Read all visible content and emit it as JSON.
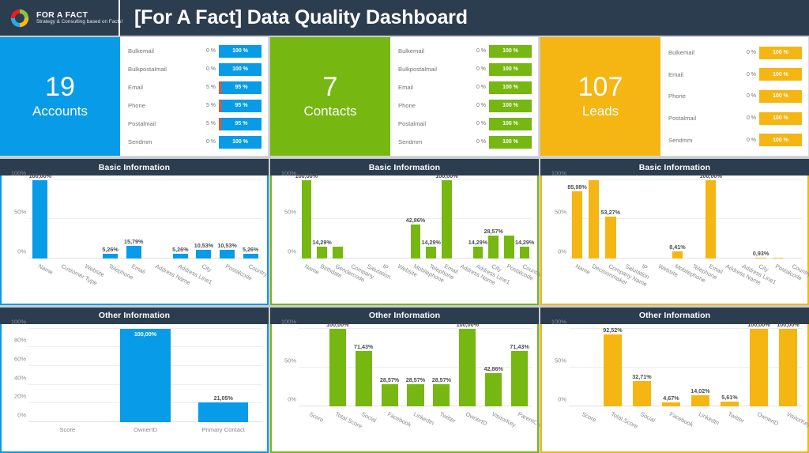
{
  "header": {
    "logo_title": "FOR A FACT",
    "logo_tagline": "Strategy & Consulting based on Facts!",
    "logo_icon": "circular-ring-logo",
    "title": "[For A Fact] Data Quality Dashboard",
    "background_color": "#2b3d4f"
  },
  "colors": {
    "accent_blue": "#079be8",
    "accent_green": "#76b711",
    "accent_orange": "#f5b512",
    "bad_red": "#e8562a",
    "panel_dark": "#2b3d4f",
    "page_background": "#c9ccd1"
  },
  "columns": [
    {
      "key": "accounts",
      "accent": "#079be8",
      "kpi": {
        "count": "19",
        "label": "Accounts",
        "rows": [
          {
            "name": "Bulkemail",
            "bad": "0 %",
            "good": "100 %",
            "bad_pct": 0
          },
          {
            "name": "Bulkpostalmail",
            "bad": "0 %",
            "good": "100 %",
            "bad_pct": 0
          },
          {
            "name": "Email",
            "bad": "5 %",
            "good": "95 %",
            "bad_pct": 5
          },
          {
            "name": "Phone",
            "bad": "5 %",
            "good": "95 %",
            "bad_pct": 5
          },
          {
            "name": "Postalmail",
            "bad": "5 %",
            "good": "95 %",
            "bad_pct": 5
          },
          {
            "name": "Sendmm",
            "bad": "0 %",
            "good": "100 %",
            "bad_pct": 0
          }
        ]
      },
      "basic_title": "Basic Information",
      "other_title": "Other Information"
    },
    {
      "key": "contacts",
      "accent": "#76b711",
      "kpi": {
        "count": "7",
        "label": "Contacts",
        "rows": [
          {
            "name": "Bulkemail",
            "bad": "0 %",
            "good": "100 %",
            "bad_pct": 0
          },
          {
            "name": "Bulkpostalmail",
            "bad": "0 %",
            "good": "100 %",
            "bad_pct": 0
          },
          {
            "name": "Email",
            "bad": "0 %",
            "good": "100 %",
            "bad_pct": 0
          },
          {
            "name": "Phone",
            "bad": "0 %",
            "good": "100 %",
            "bad_pct": 0
          },
          {
            "name": "Postalmail",
            "bad": "0 %",
            "good": "100 %",
            "bad_pct": 0
          },
          {
            "name": "Sendmm",
            "bad": "0 %",
            "good": "100 %",
            "bad_pct": 0
          }
        ]
      },
      "basic_title": "Basic Information",
      "other_title": "Other Information"
    },
    {
      "key": "leads",
      "accent": "#f5b512",
      "kpi": {
        "count": "107",
        "label": "Leads",
        "rows": [
          {
            "name": "Bulkemail",
            "bad": "0 %",
            "good": "100 %",
            "bad_pct": 0
          },
          {
            "name": "Email",
            "bad": "0 %",
            "good": "100 %",
            "bad_pct": 0
          },
          {
            "name": "Phone",
            "bad": "0 %",
            "good": "100 %",
            "bad_pct": 0
          },
          {
            "name": "Postalmail",
            "bad": "0 %",
            "good": "100 %",
            "bad_pct": 0
          },
          {
            "name": "Sendmm",
            "bad": "0 %",
            "good": "100 %",
            "bad_pct": 0
          }
        ]
      },
      "basic_title": "Basic Information",
      "other_title": "Other Information"
    }
  ],
  "chart_data": [
    {
      "id": "accounts-basic",
      "type": "bar",
      "title": "Basic Information",
      "entity": "Accounts",
      "color": "#079be8",
      "ylabel": "",
      "xlabel": "",
      "ylim": [
        0,
        100
      ],
      "yticks": [
        "0%",
        "50%",
        "100%"
      ],
      "grid": true,
      "legend": "none",
      "categories": [
        "Name",
        "Customer Type",
        "Website",
        "Telephone",
        "Email",
        "Address Name",
        "Address Line1",
        "City",
        "Postalcode",
        "Country"
      ],
      "values": [
        100.0,
        0,
        0,
        5.26,
        15.79,
        0,
        5.26,
        10.53,
        10.53,
        5.26
      ],
      "labels": [
        "100,00%",
        "",
        "",
        "5,26%",
        "15,79%",
        "",
        "5,26%",
        "10,53%",
        "10,53%",
        "5,26%"
      ]
    },
    {
      "id": "contacts-basic",
      "type": "bar",
      "title": "Basic Information",
      "entity": "Contacts",
      "color": "#76b711",
      "ylabel": "",
      "xlabel": "",
      "ylim": [
        0,
        100
      ],
      "yticks": [
        "0%",
        "50%",
        "100%"
      ],
      "grid": true,
      "legend": "none",
      "categories": [
        "Name",
        "Birthdate",
        "Gendercode",
        "Company",
        "Salutation",
        "IP",
        "Website",
        "Mobilephone",
        "Telephone",
        "Email",
        "Address Name",
        "Address Line1",
        "City",
        "Postalcode",
        "Country"
      ],
      "values": [
        100.0,
        14.29,
        14.29,
        0,
        0,
        0,
        0,
        42.86,
        14.29,
        100.0,
        0,
        14.29,
        28.57,
        28.57,
        14.29
      ],
      "labels": [
        "100,00%",
        "14,29%",
        "",
        "",
        "",
        "",
        "",
        "42,86%",
        "14,29%",
        "100,00%",
        "",
        "14,29%",
        "28,57%",
        "",
        "14,29%"
      ]
    },
    {
      "id": "leads-basic",
      "type": "bar",
      "title": "Basic Information",
      "entity": "Leads",
      "color": "#f5b512",
      "ylabel": "",
      "xlabel": "",
      "ylim": [
        0,
        100
      ],
      "yticks": [
        "0%",
        "50%",
        "100%"
      ],
      "grid": true,
      "legend": "none",
      "categories": [
        "Name",
        "Decisionmaker",
        "Company Name",
        "Salutation",
        "IP",
        "Website",
        "Mobilephone",
        "Telephone",
        "Email",
        "Address Name",
        "Address Line1",
        "City",
        "Postalcode",
        "Country"
      ],
      "values": [
        85.98,
        100.0,
        53.27,
        0,
        0,
        0,
        8.41,
        0,
        100.0,
        0,
        0,
        0.93,
        0.93,
        0
      ],
      "labels": [
        "85,98%",
        "",
        "53,27%",
        "",
        "",
        "",
        "8,41%",
        "",
        "100,00%",
        "",
        "",
        "0,93%",
        "",
        ""
      ]
    },
    {
      "id": "accounts-other",
      "type": "bar",
      "title": "Other Information",
      "entity": "Accounts",
      "color": "#079be8",
      "ylabel": "",
      "xlabel": "",
      "ylim": [
        0,
        100
      ],
      "yticks": [
        "0%",
        "20%",
        "40%",
        "60%",
        "80%",
        "100%"
      ],
      "grid": true,
      "legend": "none",
      "categories": [
        "Score",
        "OwnerID",
        "Primary Contact"
      ],
      "values": [
        0,
        100.0,
        21.05
      ],
      "labels": [
        "",
        "100,00%",
        "21,05%"
      ]
    },
    {
      "id": "contacts-other",
      "type": "bar",
      "title": "Other Information",
      "entity": "Contacts",
      "color": "#76b711",
      "ylabel": "",
      "xlabel": "",
      "ylim": [
        0,
        100
      ],
      "yticks": [
        "0%",
        "50%",
        "100%"
      ],
      "grid": true,
      "legend": "none",
      "categories": [
        "Score",
        "Total Score",
        "Social",
        "Facebook",
        "LinkedIn",
        "Twitter",
        "OwnerID",
        "VisitorKey",
        "ParentCustomer..."
      ],
      "values": [
        0,
        100.0,
        71.43,
        28.57,
        28.57,
        28.57,
        100.0,
        42.86,
        71.43
      ],
      "labels": [
        "",
        "100,00%",
        "71,43%",
        "28,57%",
        "28,57%",
        "28,57%",
        "100,00%",
        "42,86%",
        "71,43%"
      ]
    },
    {
      "id": "leads-other",
      "type": "bar",
      "title": "Other Information",
      "entity": "Leads",
      "color": "#f5b512",
      "ylabel": "",
      "xlabel": "",
      "ylim": [
        0,
        100
      ],
      "yticks": [
        "0%",
        "50%",
        "100%"
      ],
      "grid": true,
      "legend": "none",
      "categories": [
        "Score",
        "Total Score",
        "Social",
        "Facebook",
        "LinkedIn",
        "Twitter",
        "OwnerID",
        "VisitorKey"
      ],
      "values": [
        0,
        92.52,
        32.71,
        4.67,
        14.02,
        5.61,
        100.0,
        100.0
      ],
      "labels": [
        "",
        "92,52%",
        "32,71%",
        "4,67%",
        "14,02%",
        "5,61%",
        "100,00%",
        "100,00%"
      ]
    }
  ]
}
